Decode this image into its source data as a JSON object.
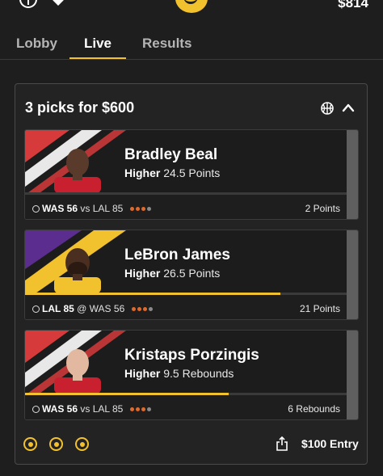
{
  "header": {
    "balance": "$814",
    "logo_icon": "logo-icon",
    "left_icons": [
      "info-icon",
      "heart-icon"
    ]
  },
  "tabs": [
    {
      "label": "Lobby",
      "active": false
    },
    {
      "label": "Live",
      "active": true
    },
    {
      "label": "Results",
      "active": false
    }
  ],
  "entry_card": {
    "title": "3 picks for $600",
    "entry_label": "$100 Entry",
    "accent_color": "#f2c12e",
    "picks": [
      {
        "player": "Bradley Beal",
        "direction": "Higher",
        "line": "24.5 Points",
        "game_team": "WAS 56",
        "game_sep": "vs",
        "game_opp": "LAL 85",
        "result": "2 Points",
        "progress": 0.0,
        "stripe_colors": [
          "#d63a3a",
          "#e8e8e8"
        ]
      },
      {
        "player": "LeBron James",
        "direction": "Higher",
        "line": "26.5 Points",
        "game_team": "LAL 85",
        "game_sep": "@",
        "game_opp": "WAS 56",
        "result": "21 Points",
        "progress": 0.79,
        "stripe_colors": [
          "#5b2d8e",
          "#f2c12e"
        ]
      },
      {
        "player": "Kristaps Porzingis",
        "direction": "Higher",
        "line": "9.5 Rebounds",
        "game_team": "WAS 56",
        "game_sep": "vs",
        "game_opp": "LAL 85",
        "result": "6 Rebounds",
        "progress": 0.63,
        "stripe_colors": [
          "#d63a3a",
          "#e8e8e8"
        ]
      }
    ]
  }
}
